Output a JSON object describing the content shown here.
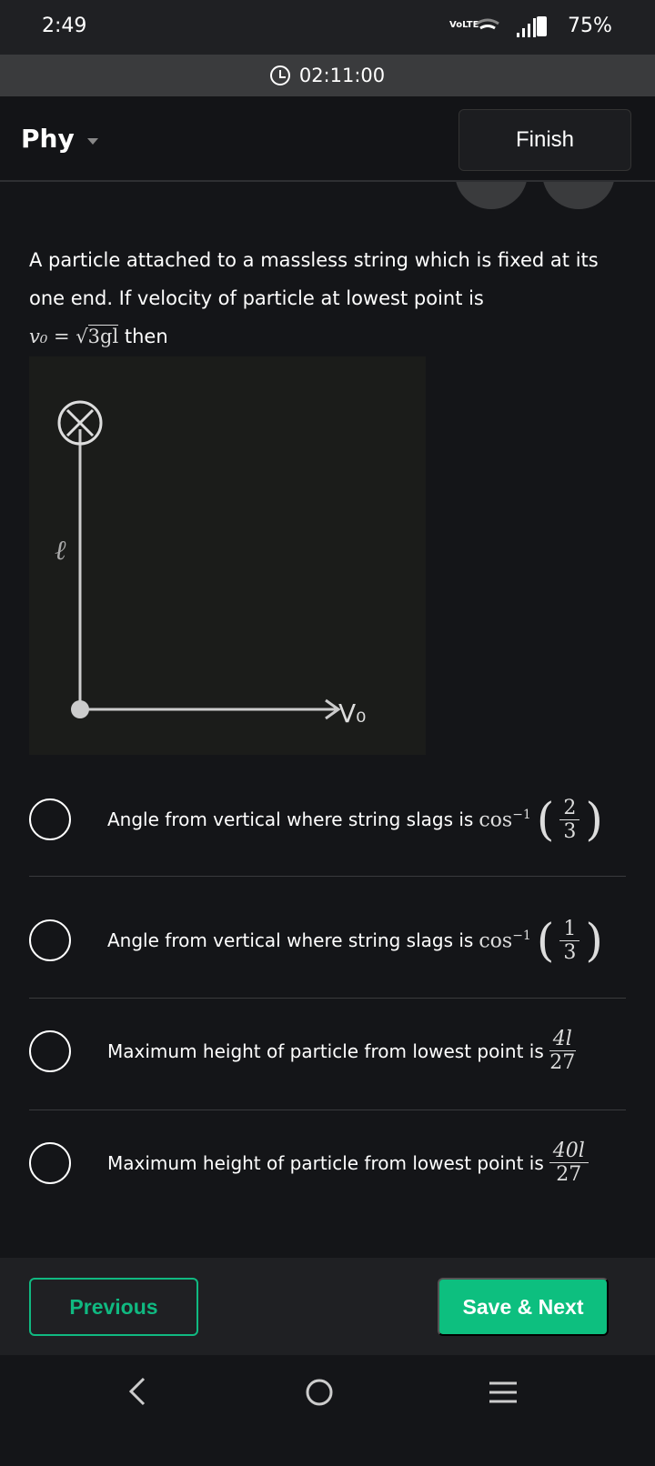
{
  "status_bar": {
    "time": "2:49",
    "network": "VoLTE",
    "battery": "75%"
  },
  "timer": {
    "value": "02:11:00"
  },
  "header": {
    "subject": "Phy",
    "finish_label": "Finish"
  },
  "question": {
    "text": "A particle attached to a massless string which is fixed at its one end. If velocity of particle at lowest point is",
    "formula_lhs": "v₀ =",
    "formula_rad": "3gl",
    "formula_tail": "then"
  },
  "diagram": {
    "length_label": "ℓ",
    "velocity_label": "V₀"
  },
  "options": [
    {
      "text": "Angle from vertical where string slags is",
      "math_fn": "cos",
      "math_exp": "−1",
      "num": "2",
      "den": "3"
    },
    {
      "text": "Angle from vertical where string slags is",
      "math_fn": "cos",
      "math_exp": "−1",
      "num": "1",
      "den": "3"
    },
    {
      "text": "Maximum height of particle from lowest point is",
      "num": "4l",
      "den": "27"
    },
    {
      "text": "Maximum height of particle from lowest point is",
      "num": "40l",
      "den": "27"
    }
  ],
  "footer": {
    "previous_label": "Previous",
    "next_label": "Save & Next"
  }
}
